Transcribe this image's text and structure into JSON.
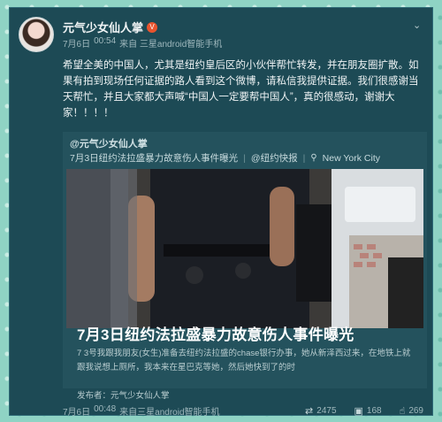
{
  "post": {
    "username": "元气少女仙人掌",
    "vip_mark": "V",
    "date": "7月6日",
    "time": "00:54",
    "source": "来自 三星android智能手机",
    "text": "希望全美的中国人，尤其是纽约皇后区的小伙伴帮忙转发，并在朋友圈扩散。如果有拍到现场任何证据的路人看到这个微博，请私信我提供证据。我们很感谢当天帮忙，并且大家都大声喊“中国人一定要帮中国人”，真的很感动，谢谢大家！！！！"
  },
  "repost": {
    "author": "@元气少女仙人掌",
    "tag_title": "7月3日纽约法拉盛暴力故意伤人事件曝光",
    "tag_topic": "@纽约快报",
    "location": "New York City",
    "article_title": "7月3日纽约法拉盛暴力故意伤人事件曝光",
    "article_excerpt": "7 3号我跟我朋友(女生)准备去纽约法拉盛的chase银行办事，她从新泽西过来，在地铁上就跟我说想上厕所，我本来在星巴克等她，然后她快到了的时",
    "article_publisher": "发布者：元气少女仙人掌"
  },
  "footer": {
    "date": "7月6日",
    "time": "00:48",
    "source": "来自三星android智能手机",
    "reposts": "2475",
    "comments": "168",
    "likes": "269"
  },
  "icons": {
    "chevron": "chevron-down-icon",
    "location": "location-pin-icon",
    "repost": "repost-icon",
    "comment": "comment-icon",
    "like": "thumbs-up-icon"
  },
  "colors": {
    "background": "#8fd3c4",
    "card": "#1d4a55",
    "repost": "#24525d",
    "vip": "#e8542e"
  }
}
